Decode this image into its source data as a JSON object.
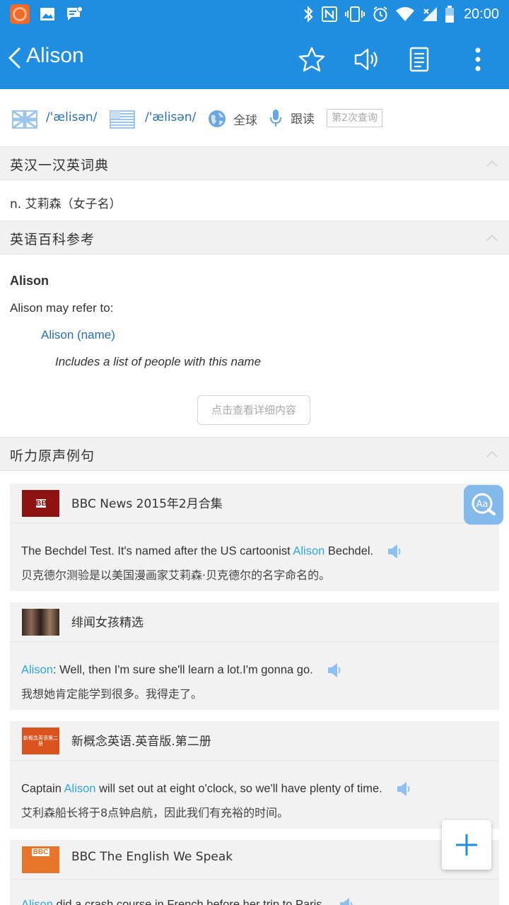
{
  "status_bar": {
    "time": "20:00"
  },
  "app_bar": {
    "title": "Alison"
  },
  "pronunciation": {
    "uk_phonetic": "/'ælisən/",
    "us_phonetic": "/'ælisən/",
    "global_label": "全球",
    "follow_read_label": "跟读",
    "query_count_badge": "第2次查询"
  },
  "sections": {
    "dict_title": "英汉一汉英词典",
    "dict_definition": "n. 艾莉森（女子名）",
    "wiki_title": "英语百科参考",
    "wiki_heading": "Alison",
    "wiki_intro": "Alison may refer to:",
    "wiki_link": "Alison (name)",
    "wiki_note": "Includes a list of people with this name",
    "wiki_more_button": "点击查看详细内容",
    "listening_title": "听力原声例句"
  },
  "examples": [
    {
      "source": "BBC News 2015年2月合集",
      "thumb_text": "BBC",
      "en_before": "The Bechdel Test. It's named after the US cartoonist ",
      "en_highlight": "Alison",
      "en_after": " Bechdel.",
      "zh": "贝克德尔测验是以美国漫画家艾莉森·贝克德尔的名字命名的。"
    },
    {
      "source": "绯闻女孩精选",
      "thumb_text": "",
      "en_before": "",
      "en_highlight": "Alison",
      "en_after": ": Well, then I'm sure she'll learn a lot.I'm gonna go.",
      "zh": "我想她肯定能学到很多。我得走了。"
    },
    {
      "source": "新概念英语.英音版.第二册",
      "thumb_text": "新概念英语第二册",
      "en_before": "Captain ",
      "en_highlight": "Alison",
      "en_after": " will set out at eight o'clock, so we'll have plenty of time.",
      "zh": "艾利森船长将于8点钟启航，因此我们有充裕的时间。"
    },
    {
      "source": "BBC The English We Speak",
      "thumb_text": "BBC",
      "en_before": "",
      "en_highlight": "Alison",
      "en_after": " did a crash course in French before her trip to Paris.",
      "zh": ""
    }
  ],
  "colors": {
    "primary": "#1f8ee0",
    "highlight": "#2fa7dc",
    "link": "#2a6fb0"
  }
}
